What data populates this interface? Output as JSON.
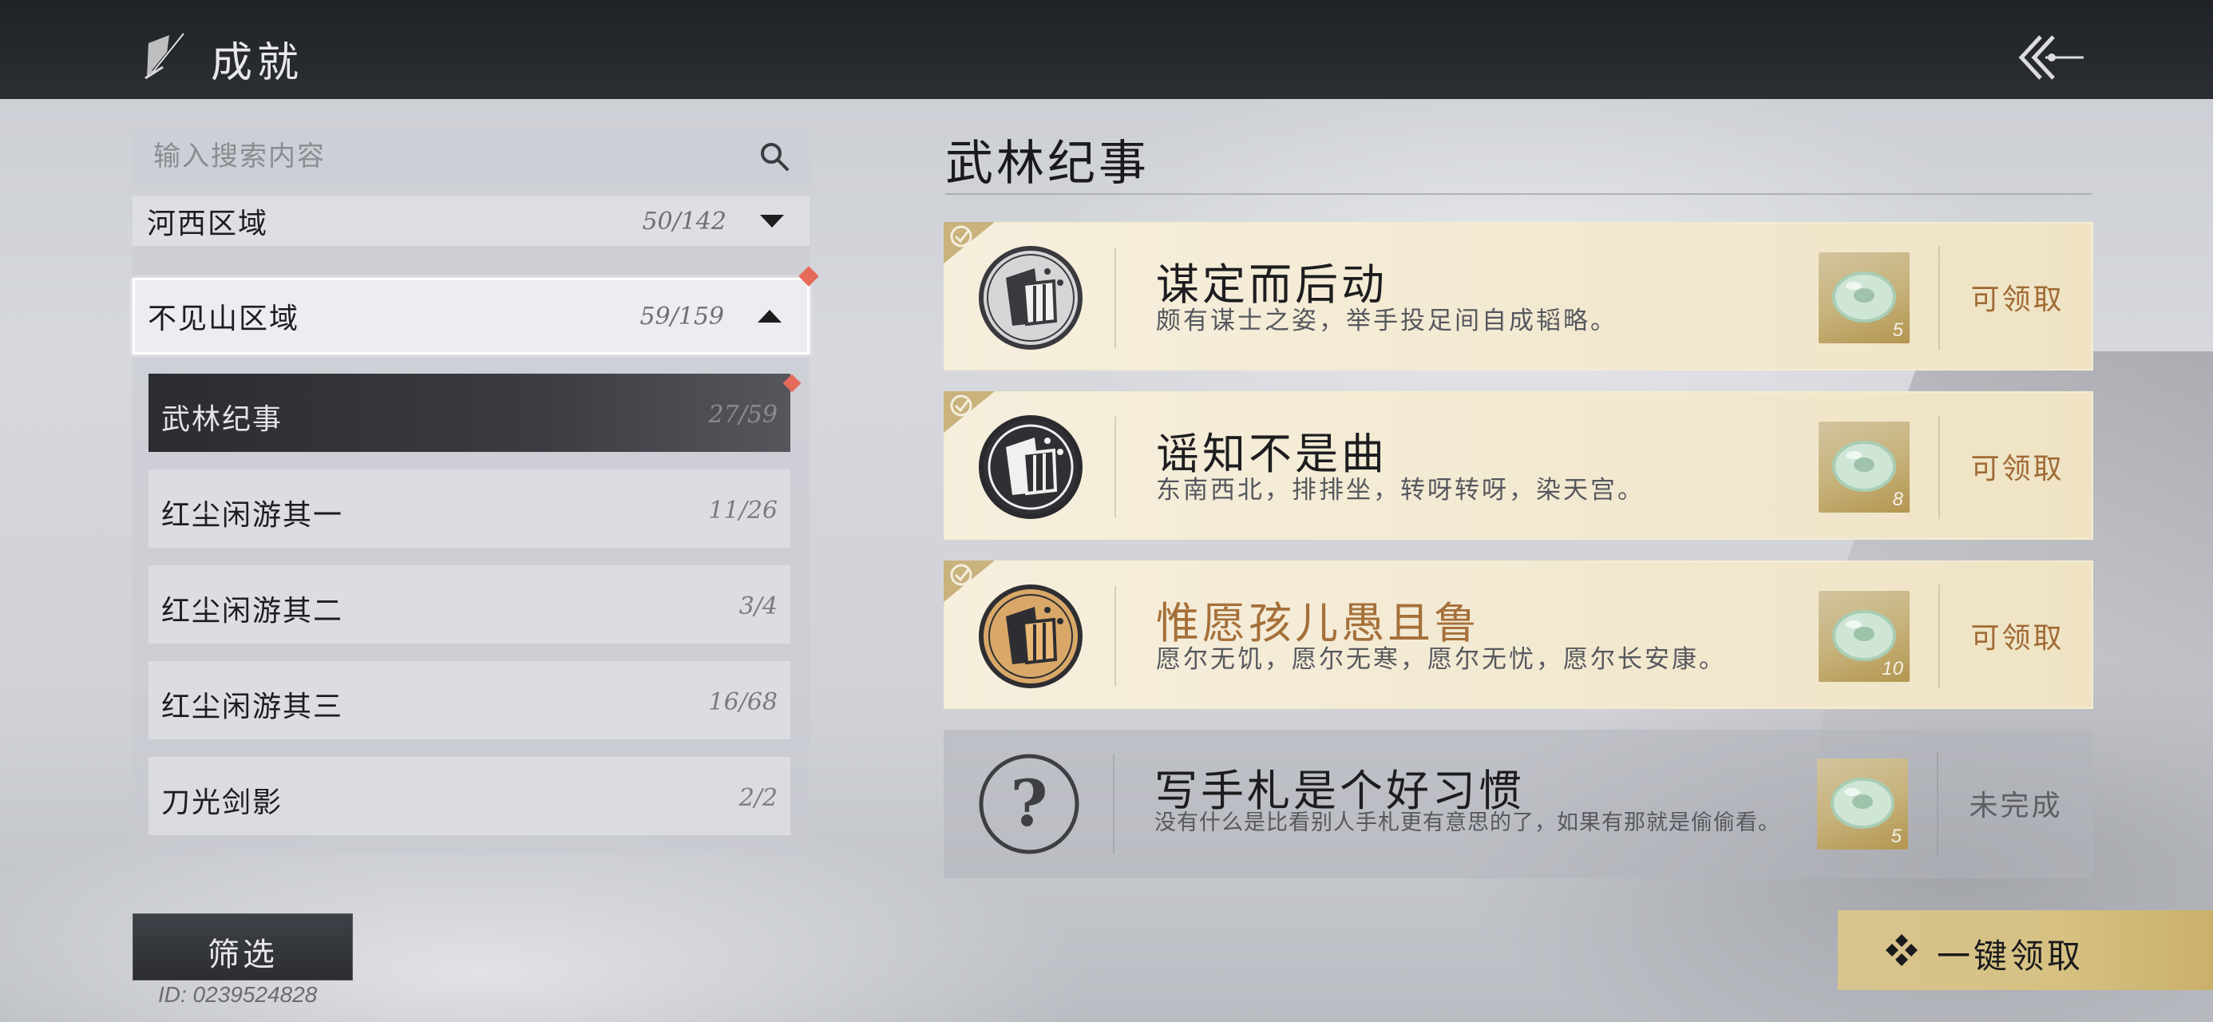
{
  "header": {
    "title": "成就",
    "title_icon": "quill-icon",
    "back_icon": "back-arrow-icon"
  },
  "search": {
    "placeholder": "输入搜索内容",
    "value": "",
    "icon": "search-icon"
  },
  "regions": [
    {
      "name": "河西区域",
      "count": "50/142",
      "expanded": false
    },
    {
      "name": "不见山区域",
      "count": "59/159",
      "expanded": true
    }
  ],
  "categories": [
    {
      "name": "武林纪事",
      "count": "27/59",
      "active": true
    },
    {
      "name": "红尘闲游其一",
      "count": "11/26"
    },
    {
      "name": "红尘闲游其二",
      "count": "3/4"
    },
    {
      "name": "红尘闲游其三",
      "count": "16/68"
    },
    {
      "name": "刀光剑影",
      "count": "2/2"
    }
  ],
  "filter_label": "筛选",
  "user_id": "ID: 0239524828",
  "section_title": "武林纪事",
  "achievements": [
    {
      "name": "谋定而后动",
      "desc": "颇有谋士之姿，举手投足间自成韬略。",
      "reward_qty": "5",
      "status": "可领取",
      "completed": true,
      "highlight": false
    },
    {
      "name": "谣知不是曲",
      "desc": "东南西北，排排坐，转呀转呀，染天宫。",
      "reward_qty": "8",
      "status": "可领取",
      "completed": true,
      "highlight": false
    },
    {
      "name": "惟愿孩儿愚且鲁",
      "desc": "愿尔无饥，愿尔无寒，愿尔无忧，愿尔长安康。",
      "reward_qty": "10",
      "status": "可领取",
      "completed": true,
      "highlight": true
    },
    {
      "name": "写手札是个好习惯",
      "desc": "没有什么是比看别人手札更有意思的了，如果有那就是偷偷看。",
      "reward_qty": "5",
      "status": "未完成",
      "completed": false,
      "highlight": false
    }
  ],
  "claim_all_label": "一键领取",
  "colors": {
    "gold_text": "#a06a34",
    "highlight_name": "#a5703a",
    "red_dot": "#e66a5a",
    "claim_all_bg": "#d6c182"
  }
}
